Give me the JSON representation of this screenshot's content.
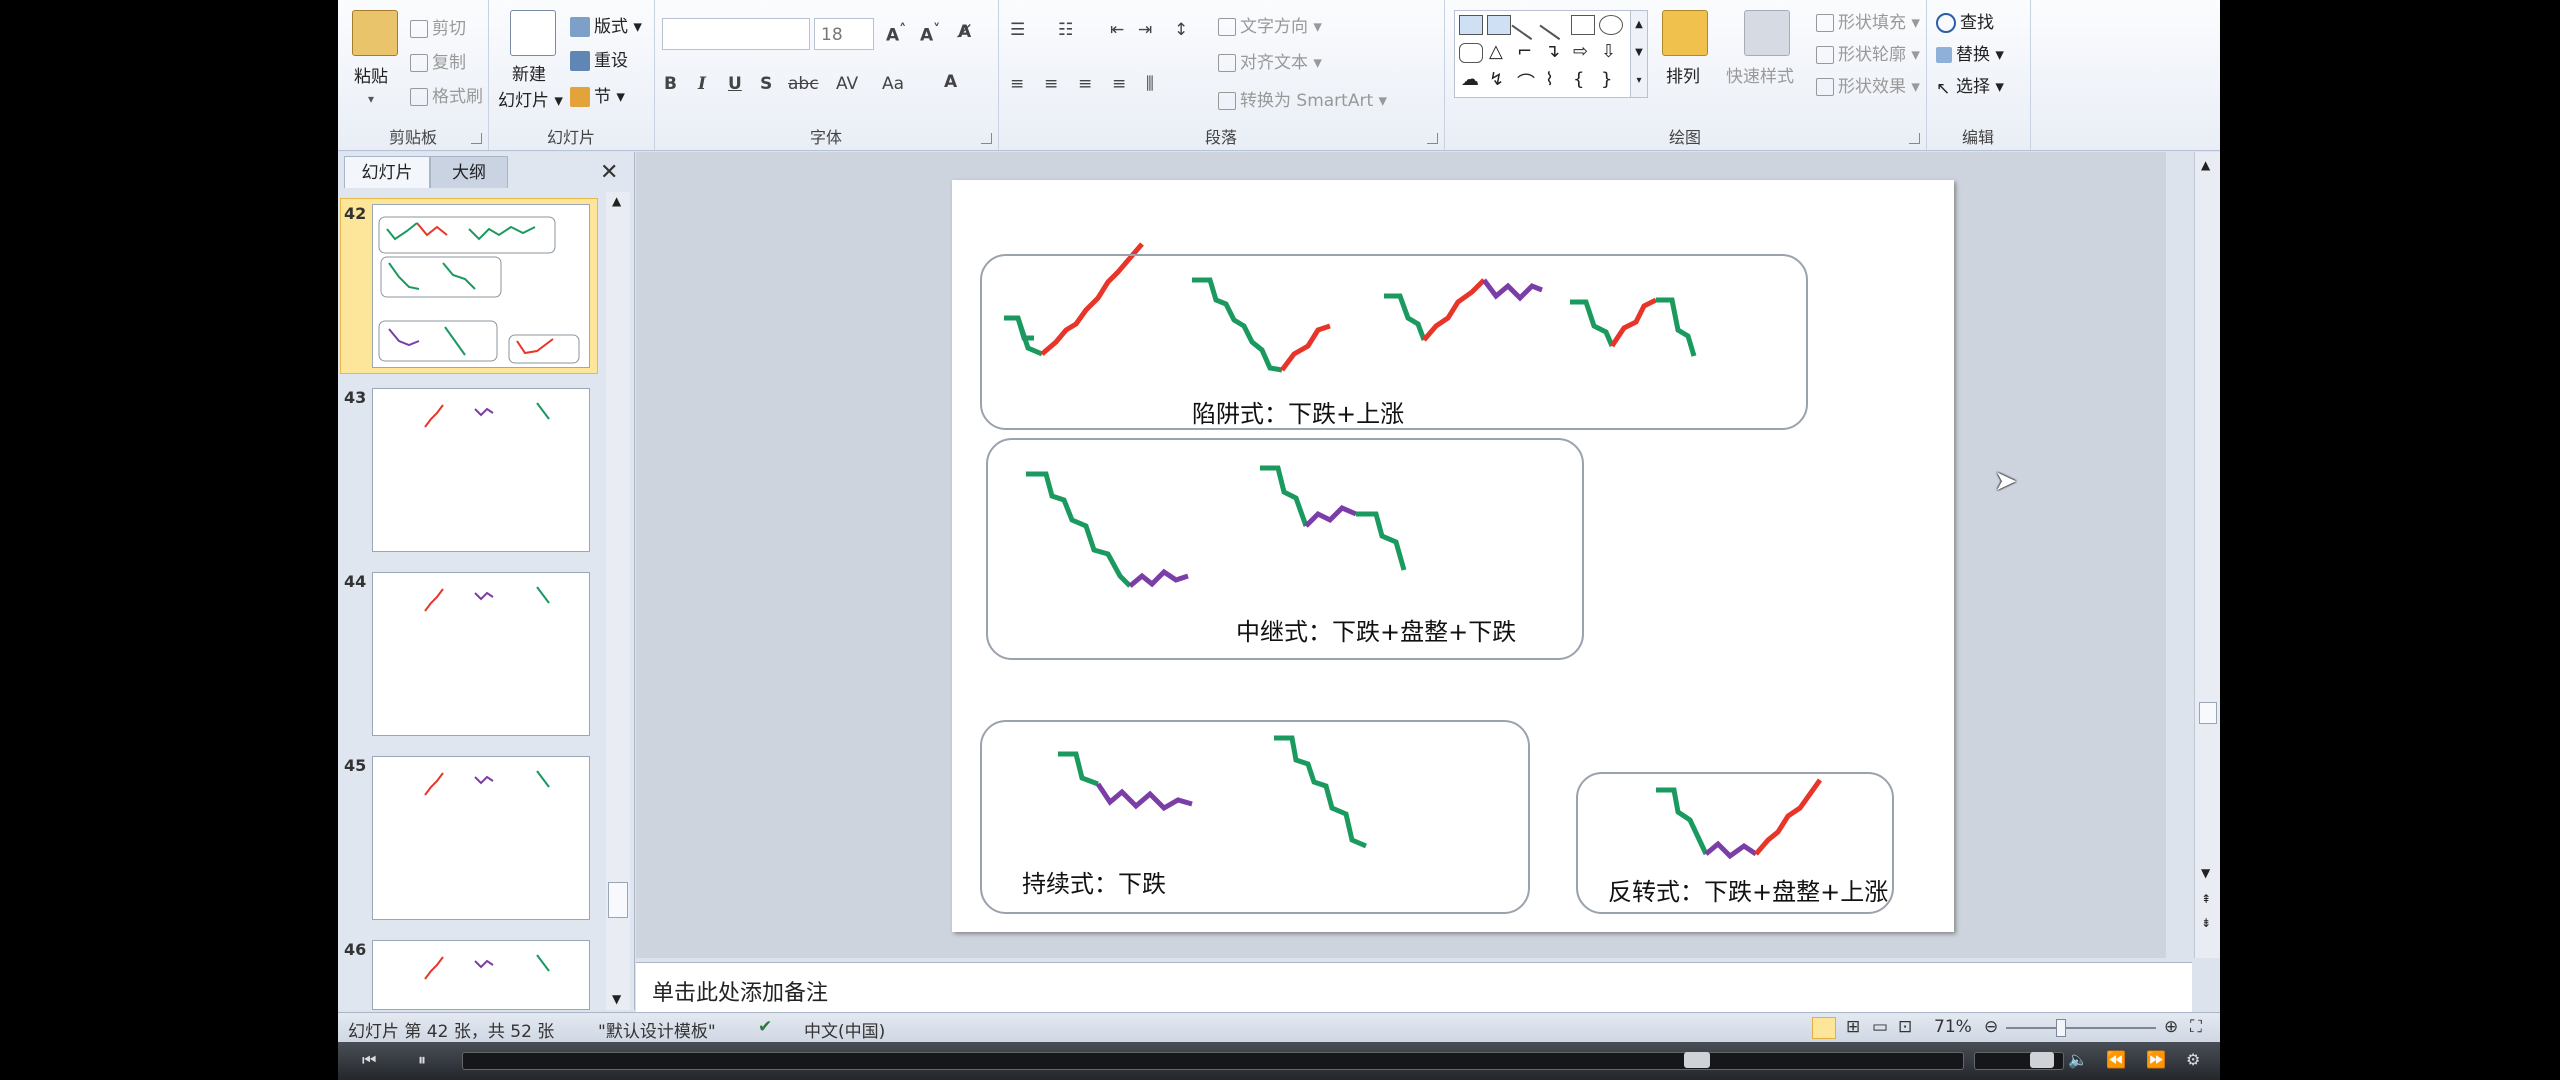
{
  "ribbon": {
    "clipboard": {
      "group_label": "剪贴板",
      "paste": "粘贴",
      "cut": "剪切",
      "copy": "复制",
      "format_painter": "格式刷"
    },
    "slides": {
      "group_label": "幻灯片",
      "new_slide_line1": "新建",
      "new_slide_line2": "幻灯片",
      "layout": "版式",
      "reset": "重设",
      "section": "节"
    },
    "font": {
      "group_label": "字体",
      "font_name": "",
      "font_size": "18"
    },
    "paragraph": {
      "group_label": "段落",
      "text_direction": "文字方向",
      "align_text": "对齐文本",
      "smartart": "转换为 SmartArt"
    },
    "drawing": {
      "group_label": "绘图",
      "arrange": "排列",
      "quick_styles": "快速样式",
      "shape_fill": "形状填充",
      "shape_outline": "形状轮廓",
      "shape_effects": "形状效果"
    },
    "editing": {
      "group_label": "编辑",
      "find": "查找",
      "replace": "替换",
      "select": "选择"
    }
  },
  "left_pane": {
    "tabs": [
      "幻灯片",
      "大纲"
    ],
    "thumbnails": [
      {
        "number": "42",
        "selected": true
      },
      {
        "number": "43",
        "selected": false
      },
      {
        "number": "44",
        "selected": false
      },
      {
        "number": "45",
        "selected": false
      },
      {
        "number": "46",
        "selected": false
      }
    ]
  },
  "slide": {
    "caption_trap": "陷阱式：下跌+上涨",
    "caption_relay": "中继式：下跌+盘整+下跌",
    "caption_continuation": "持续式：下跌",
    "caption_reversal": "反转式：下跌+盘整+上涨"
  },
  "notes": {
    "placeholder": "单击此处添加备注"
  },
  "status": {
    "slide_info": "幻灯片 第 42 张，共 52 张",
    "theme": "\"默认设计模板\"",
    "language": "中文(中国)",
    "zoom": "71%"
  },
  "colors": {
    "down": "#1a9a5e",
    "up": "#e8352a",
    "consolidation": "#7a3ea6",
    "accent": "#f6c648"
  }
}
